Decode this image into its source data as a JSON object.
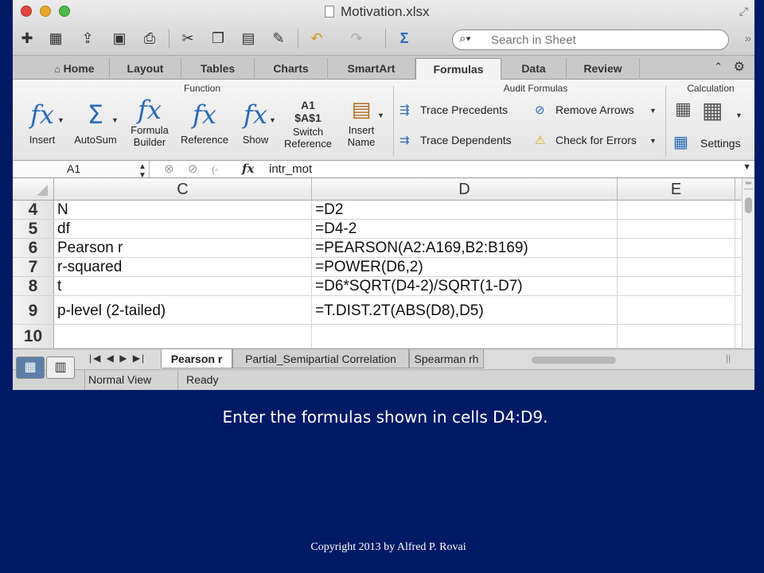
{
  "window": {
    "title": "Motivation.xlsx"
  },
  "toolbar": {
    "icons": [
      "new-icon",
      "templates-icon",
      "open-icon",
      "save-icon",
      "print-icon",
      "cut-icon",
      "copy-icon",
      "paste-icon",
      "format-painter-icon",
      "undo-icon",
      "redo-icon",
      "sum-icon"
    ],
    "search_placeholder": "Search in Sheet"
  },
  "tabs": [
    "Home",
    "Layout",
    "Tables",
    "Charts",
    "SmartArt",
    "Formulas",
    "Data",
    "Review"
  ],
  "active_tab": "Formulas",
  "ribbon": {
    "function_group": {
      "label": "Function",
      "buttons": [
        {
          "label": "Insert"
        },
        {
          "label": "AutoSum"
        },
        {
          "label": "Formula Builder"
        },
        {
          "label": "Reference"
        },
        {
          "label": "Show"
        },
        {
          "label": "Switch Reference"
        },
        {
          "label": "Insert Name"
        }
      ],
      "switch_icon_text_1": "A1",
      "switch_icon_text_2": "$A$1"
    },
    "audit_group": {
      "label": "Audit Formulas",
      "trace_precedents": "Trace Precedents",
      "trace_dependents": "Trace Dependents",
      "remove_arrows": "Remove Arrows",
      "check_errors": "Check for Errors"
    },
    "calculation_group": {
      "label": "Calculation",
      "settings": "Settings"
    }
  },
  "formula_bar": {
    "name_box": "A1",
    "fx": "fx",
    "formula": "intr_mot"
  },
  "columns": [
    "C",
    "D",
    "E"
  ],
  "rows": [
    {
      "num": "4",
      "c": "N",
      "d": "=D2"
    },
    {
      "num": "5",
      "c": "df",
      "d": "=D4-2"
    },
    {
      "num": "6",
      "c": "Pearson r",
      "d": "=PEARSON(A2:A169,B2:B169)"
    },
    {
      "num": "7",
      "c": "r-squared",
      "d": "=POWER(D6,2)"
    },
    {
      "num": "8",
      "c": "t",
      "d": "=D6*SQRT(D4-2)/SQRT(1-D7)"
    },
    {
      "num": "9",
      "c": "p-level (2-tailed)",
      "d": "=T.DIST.2T(ABS(D8),D5)"
    },
    {
      "num": "10",
      "c": "",
      "d": ""
    }
  ],
  "sheet_tabs": [
    "Pearson r",
    "Partial_Semipartial Correlation",
    "Spearman rh"
  ],
  "active_sheet": "Pearson r",
  "status": {
    "view": "Normal View",
    "state": "Ready"
  },
  "slide": {
    "caption": "Enter the formulas shown in cells D4:D9.",
    "copyright": "Copyright 2013 by Alfred P. Rovai"
  },
  "colors": {
    "slide_background": "#001a66",
    "ribbon_icon": "#2a6bb8"
  }
}
